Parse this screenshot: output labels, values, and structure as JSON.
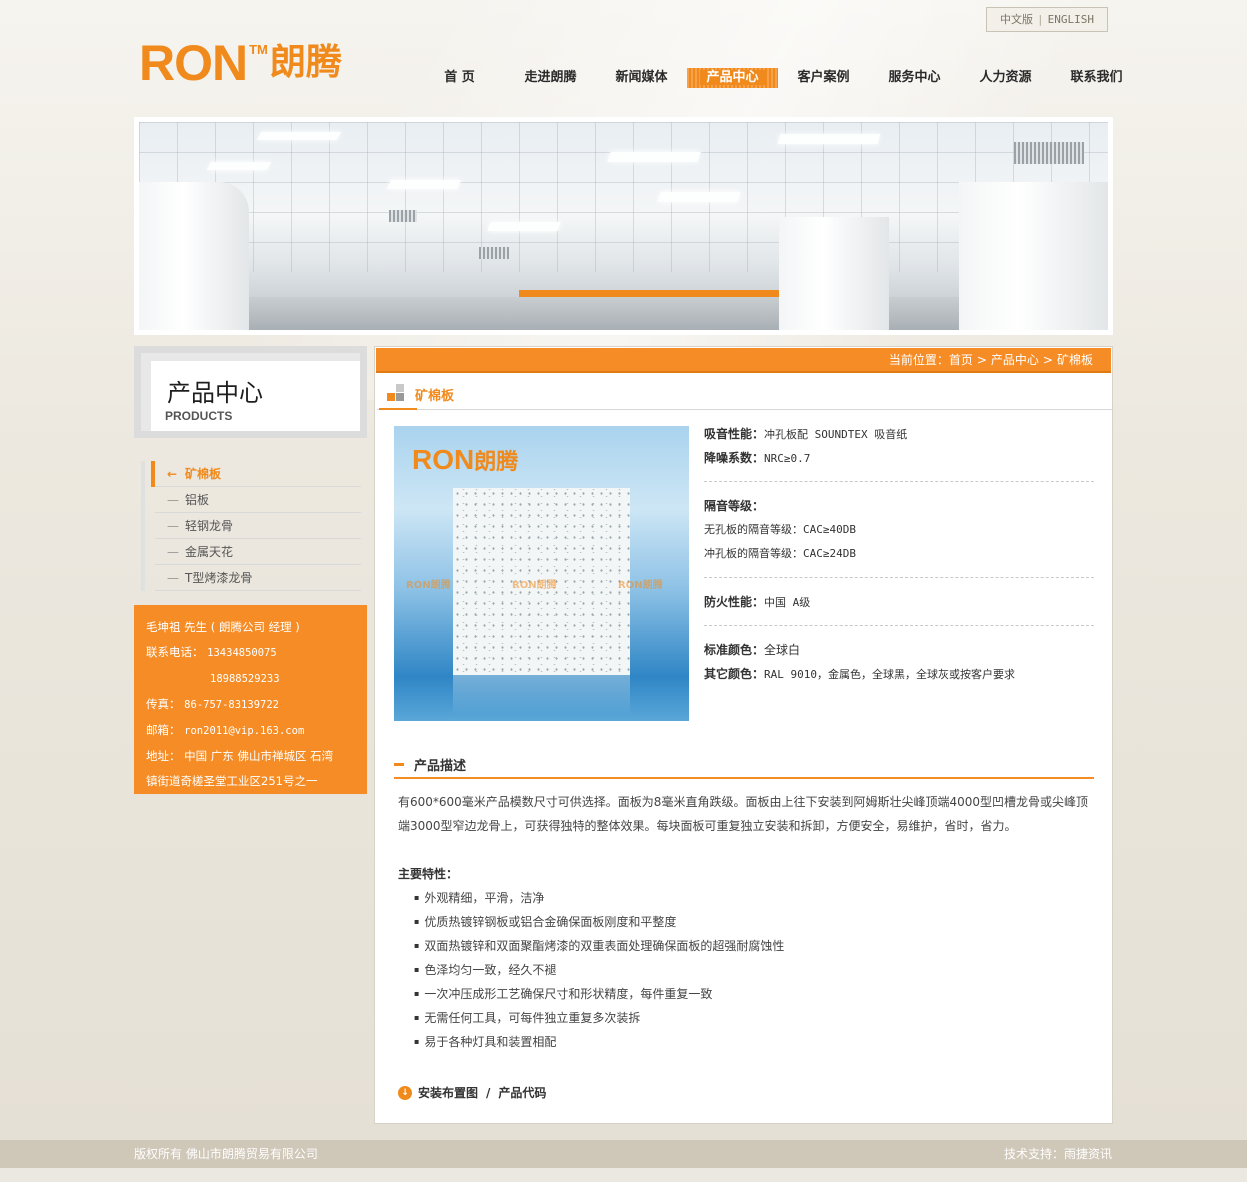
{
  "language": {
    "chinese": "中文版",
    "english": "ENGLISH"
  },
  "logo": {
    "brand": "RON",
    "tm": "TM",
    "cn": "朗腾"
  },
  "nav": [
    {
      "label": "首 页"
    },
    {
      "label": "走进朗腾"
    },
    {
      "label": "新闻媒体"
    },
    {
      "label": "产品中心",
      "active": true
    },
    {
      "label": "客户案例"
    },
    {
      "label": "服务中心"
    },
    {
      "label": "人力资源"
    },
    {
      "label": "联系我们"
    }
  ],
  "sidebar": {
    "title_cn": "产品中心",
    "title_en": "PRODUCTS",
    "items": [
      {
        "label": "矿棉板",
        "active": true
      },
      {
        "label": "铝板"
      },
      {
        "label": "轻钢龙骨"
      },
      {
        "label": "金属天花"
      },
      {
        "label": "T型烤漆龙骨"
      }
    ]
  },
  "contact": {
    "name": "毛坤祖 先生 ( 朗腾公司 经理 )",
    "phone_label": "联系电话：",
    "phone1": "13434850075",
    "phone2": "18988529233",
    "fax_label": "传真：",
    "fax": "86-757-83139722",
    "email_label": "邮箱：",
    "email": "ron2011@vip.163.com",
    "address_label": "地址：",
    "address_line1": "中国 广东 佛山市禅城区 石湾",
    "address_line2": "镇街道奇槎圣堂工业区251号之一"
  },
  "breadcrumb": {
    "prefix": "当前位置：",
    "items": [
      "首页",
      "产品中心",
      "矿棉板"
    ]
  },
  "product": {
    "title": "矿棉板",
    "image_logo": "RON",
    "image_logo_cn": "朗腾",
    "watermark": "RON朗腾",
    "specs": {
      "absorb_label": "吸音性能：",
      "absorb_value": "冲孔板配 SOUNDTEX 吸音纸",
      "nrc_label": "降噪系数：",
      "nrc_value": "NRC≥0.7",
      "isolation_label": "隔音等级：",
      "isolation_1": "无孔板的隔音等级：CAC≥40DB",
      "isolation_2": "冲孔板的隔音等级：CAC≥24DB",
      "fire_label": "防火性能：",
      "fire_value": "中国 A级",
      "std_color_label": "标准颜色：",
      "std_color_value": "全球白",
      "other_color_label": "其它颜色：",
      "other_color_value": "RAL 9010，金属色，全球黑，全球灰或按客户要求"
    },
    "description_title": "产品描述",
    "description": "有600*600毫米产品模数尺寸可供选择。面板为8毫米直角跌级。面板由上往下安装到阿姆斯壮尖峰顶端4000型凹槽龙骨或尖峰顶端3000型窄边龙骨上，可获得独特的整体效果。每块面板可重复独立安装和拆卸，方便安全，易维护，省时，省力。",
    "features_title": "主要特性：",
    "features": [
      "外观精细，平滑，洁净",
      "优质热镀锌钢板或铝合金确保面板刚度和平整度",
      "双面热镀锌和双面聚酯烤漆的双重表面处理确保面板的超强耐腐蚀性",
      "色泽均匀一致，经久不褪",
      "一次冲压成形工艺确保尺寸和形状精度，每件重复一致",
      "无需任何工具，可每件独立重复多次装拆",
      "易于各种灯具和装置相配"
    ],
    "install_link": "安装布置图",
    "code_link": "产品代码"
  },
  "footer": {
    "copyright": "版权所有 佛山市朗腾贸易有限公司",
    "support": "技术支持：雨捷资讯"
  },
  "colors": {
    "accent": "#f08a1c",
    "accent_light": "#f68c26",
    "footer": "#cfc7b8"
  }
}
